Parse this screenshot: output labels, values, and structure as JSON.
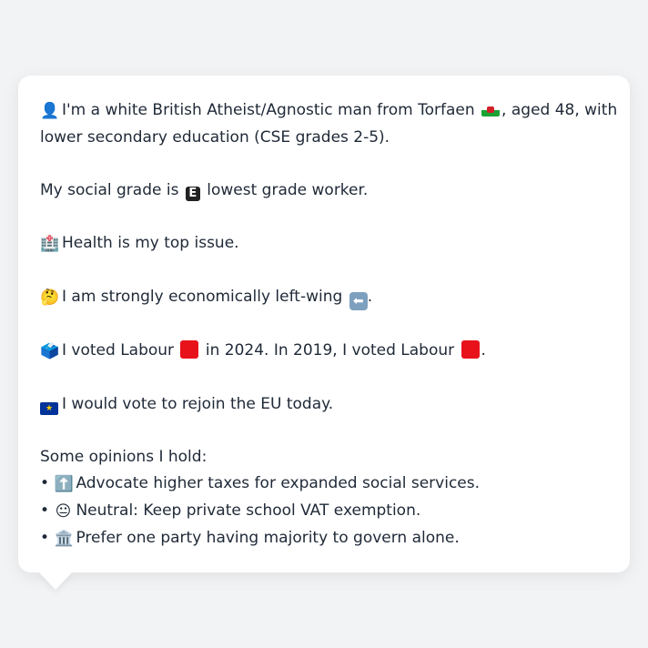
{
  "profile": {
    "line1_pre": "I'm a white British Atheist/Agnostic man from Torfaen",
    "line1_post": ", aged 48, with",
    "line2": "lower secondary education (CSE grades 2-5).",
    "social_pre": "My social grade is",
    "social_badge": "E",
    "social_post": "lowest grade worker.",
    "health": "Health is my top issue.",
    "econ_pre": "I am strongly economically left-wing",
    "econ_post": ".",
    "vote_a": "I voted Labour",
    "vote_b": "in 2024. In 2019, I voted Labour",
    "vote_c": ".",
    "eu": "I would vote to rejoin the EU today.",
    "opinions_heading": "Some opinions I hold:",
    "bullet": "•",
    "opinions": [
      "Advocate higher taxes for expanded social services.",
      "Neutral: Keep private school VAT exemption.",
      "Prefer one party having majority to govern alone."
    ]
  },
  "icons": {
    "person": "👤",
    "hospital": "🏥",
    "thinking": "🤔",
    "ballot": "🗳️",
    "up": "⬆️",
    "neutral": "😐",
    "classical": "🏛️",
    "left_arrow": "⬅",
    "eu_stars": "★"
  },
  "colors": {
    "background": "#f2f3f5",
    "card": "#ffffff",
    "text": "#1f2937",
    "labour_red": "#e8121b"
  }
}
